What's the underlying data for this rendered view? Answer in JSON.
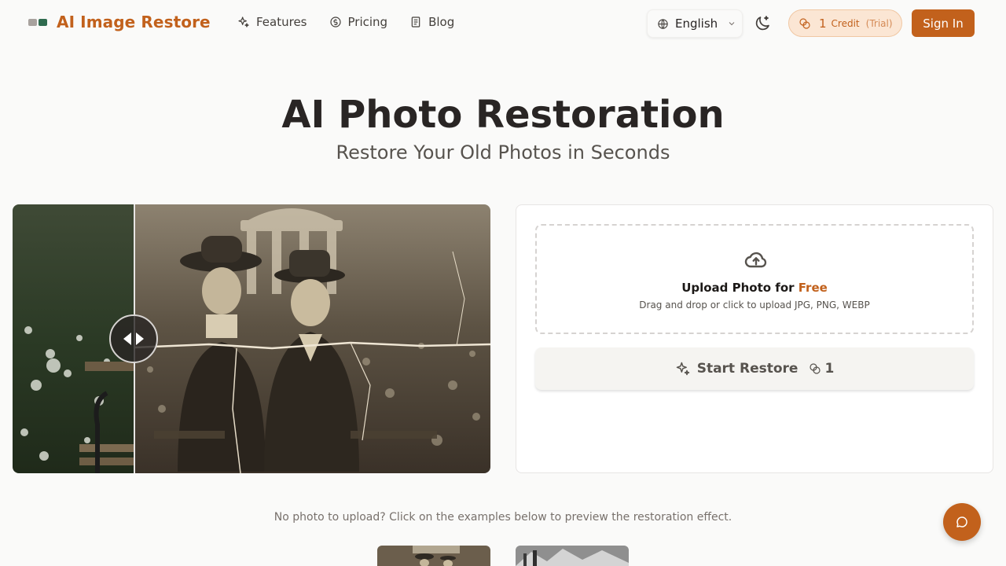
{
  "nav": {
    "brand": "AI Image Restore",
    "links": [
      {
        "label": "Features",
        "icon": "sparkles-icon"
      },
      {
        "label": "Pricing",
        "icon": "coin-icon"
      },
      {
        "label": "Blog",
        "icon": "document-icon"
      }
    ],
    "language": "English",
    "credits": {
      "count": "1",
      "label": "Credit",
      "note": "(Trial)"
    },
    "sign_in": "Sign In"
  },
  "hero": {
    "title": "AI Photo Restoration",
    "subtitle": "Restore Your Old Photos in Seconds"
  },
  "upload": {
    "title_prefix": "Upload Photo for ",
    "title_highlight": "Free",
    "hint": "Drag and drop or click to upload JPG, PNG, WEBP",
    "start_label": "Start Restore",
    "start_cost": "1"
  },
  "examples": {
    "hint": "No photo to upload? Click on the examples below to preview the restoration effect."
  },
  "colors": {
    "brand": "#c2611c",
    "background": "#fafaf9"
  }
}
